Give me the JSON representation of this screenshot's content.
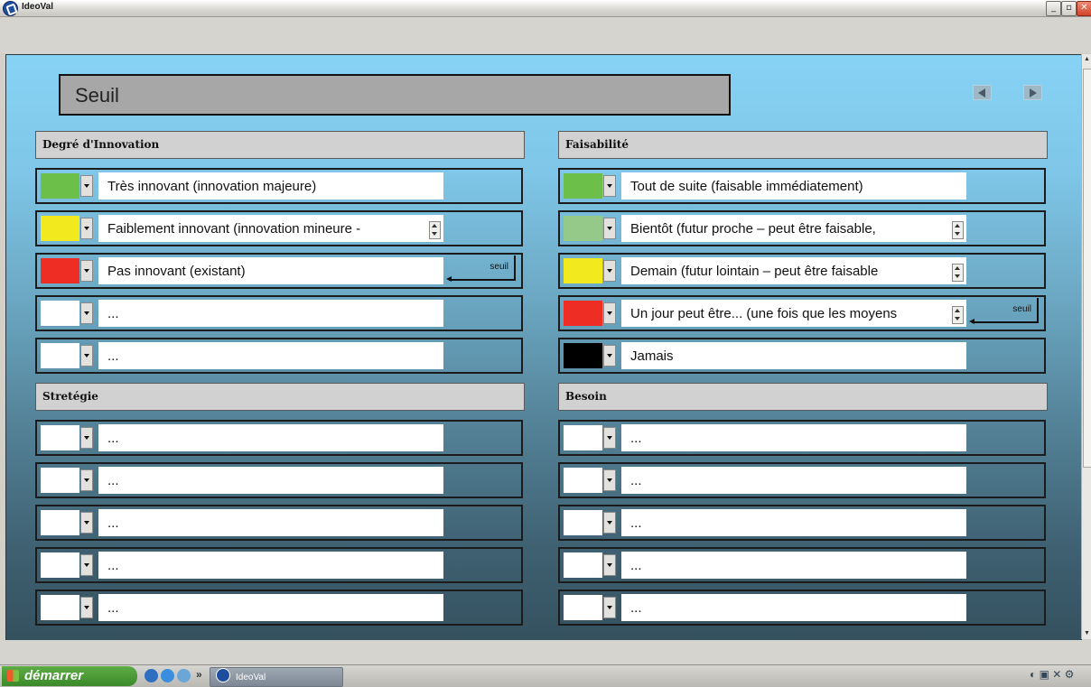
{
  "window": {
    "title": "IdeoVal",
    "buttons": {
      "minimize": "_",
      "maximize": "▫",
      "close": "✕"
    }
  },
  "header": {
    "title": "Seuil",
    "nav": {
      "prev": "◀",
      "next": "▶"
    }
  },
  "sections": [
    {
      "title": "Degré d'Innovation",
      "rows": [
        {
          "color": "#6cc04a",
          "text": "Très innovant (innovation majeure)",
          "spinner": false,
          "threshold": false
        },
        {
          "color": "#f2ea1f",
          "text": "Faiblement innovant (innovation mineure -",
          "spinner": true,
          "threshold": false
        },
        {
          "color": "#ee2d24",
          "text": "Pas innovant (existant)",
          "spinner": false,
          "threshold": true
        },
        {
          "color": "#ffffff",
          "text": "...",
          "spinner": false,
          "threshold": false
        },
        {
          "color": "#ffffff",
          "text": "...",
          "spinner": false,
          "threshold": false
        }
      ]
    },
    {
      "title": "Faisabilité",
      "rows": [
        {
          "color": "#6cc04a",
          "text": "Tout de suite (faisable immédiatement)",
          "spinner": false,
          "threshold": false
        },
        {
          "color": "#94c98a",
          "text": "Bientôt (futur proche – peut être faisable,",
          "spinner": true,
          "threshold": false
        },
        {
          "color": "#f2ea1f",
          "text": "Demain (futur lointain – peut être faisable",
          "spinner": true,
          "threshold": false
        },
        {
          "color": "#ee2d24",
          "text": "Un jour peut être... (une fois que les moyens",
          "spinner": true,
          "threshold": true
        },
        {
          "color": "#000000",
          "text": "Jamais",
          "spinner": false,
          "threshold": false
        }
      ]
    },
    {
      "title": "Stretégie",
      "rows": [
        {
          "color": "#ffffff",
          "text": "...",
          "spinner": false,
          "threshold": false
        },
        {
          "color": "#ffffff",
          "text": "...",
          "spinner": false,
          "threshold": false
        },
        {
          "color": "#ffffff",
          "text": "...",
          "spinner": false,
          "threshold": false
        },
        {
          "color": "#ffffff",
          "text": "...",
          "spinner": false,
          "threshold": false
        },
        {
          "color": "#ffffff",
          "text": "...",
          "spinner": false,
          "threshold": false
        }
      ]
    },
    {
      "title": "Besoin",
      "rows": [
        {
          "color": "#ffffff",
          "text": "...",
          "spinner": false,
          "threshold": false
        },
        {
          "color": "#ffffff",
          "text": "...",
          "spinner": false,
          "threshold": false
        },
        {
          "color": "#ffffff",
          "text": "...",
          "spinner": false,
          "threshold": false
        },
        {
          "color": "#ffffff",
          "text": "...",
          "spinner": false,
          "threshold": false
        },
        {
          "color": "#ffffff",
          "text": "...",
          "spinner": false,
          "threshold": false
        }
      ]
    }
  ],
  "threshold_label": "seuil",
  "taskbar": {
    "start_label": "démarrer",
    "quicklaunch_more": "»",
    "task_label": "IdeoVal"
  }
}
